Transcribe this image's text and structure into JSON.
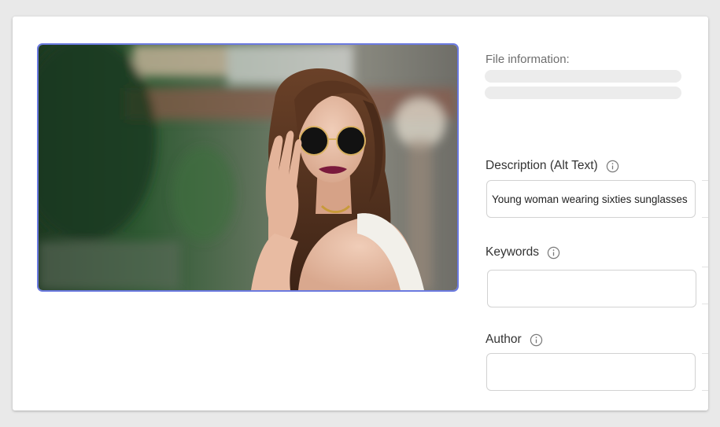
{
  "photo": {
    "alt": "Young woman wearing sixties sunglasses",
    "frame_color": "#6b7ae0"
  },
  "file_info": {
    "label": "File information:"
  },
  "fields": {
    "description": {
      "label": "Description (Alt Text)",
      "value": "Young woman wearing sixties sunglasses",
      "icon": "info-icon"
    },
    "keywords": {
      "label": "Keywords",
      "value": "",
      "icon": "info-icon"
    },
    "author": {
      "label": "Author",
      "value": "",
      "icon": "info-icon"
    }
  }
}
